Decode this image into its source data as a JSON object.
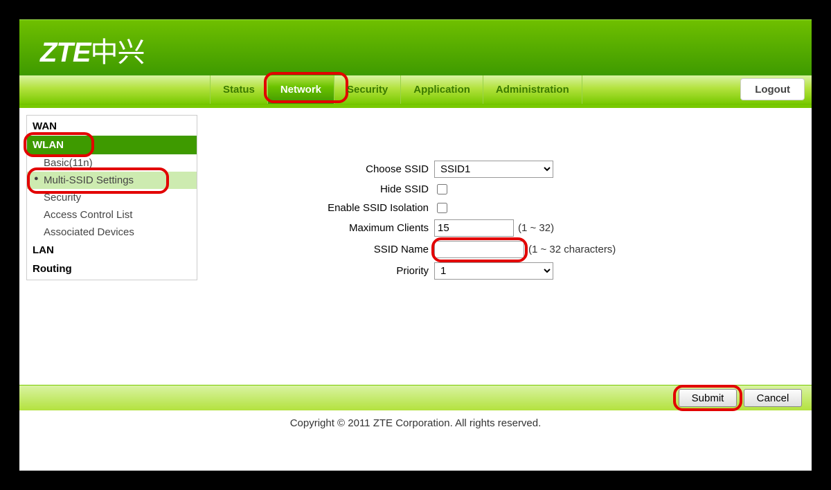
{
  "brand": {
    "zte": "ZTE",
    "cn": "中兴"
  },
  "nav": {
    "tabs": {
      "status": "Status",
      "network": "Network",
      "security": "Security",
      "application": "Application",
      "administration": "Administration"
    },
    "logout": "Logout"
  },
  "sidebar": {
    "wan": "WAN",
    "wlan": "WLAN",
    "wlan_items": {
      "basic": "Basic(11n)",
      "multi": "Multi-SSID Settings",
      "security": "Security",
      "acl": "Access Control List",
      "assoc": "Associated Devices"
    },
    "lan": "LAN",
    "routing": "Routing"
  },
  "form": {
    "labels": {
      "choose": "Choose SSID",
      "hide": "Hide SSID",
      "isol": "Enable SSID Isolation",
      "max": "Maximum Clients",
      "name": "SSID Name",
      "prio": "Priority"
    },
    "values": {
      "ssid": "SSID1",
      "max": "15",
      "name": "",
      "prio": "1"
    },
    "hints": {
      "max": "(1 ~ 32)",
      "name": "(1 ~ 32 characters)"
    }
  },
  "buttons": {
    "submit": "Submit",
    "cancel": "Cancel"
  },
  "copyright": "Copyright © 2011 ZTE Corporation. All rights reserved."
}
